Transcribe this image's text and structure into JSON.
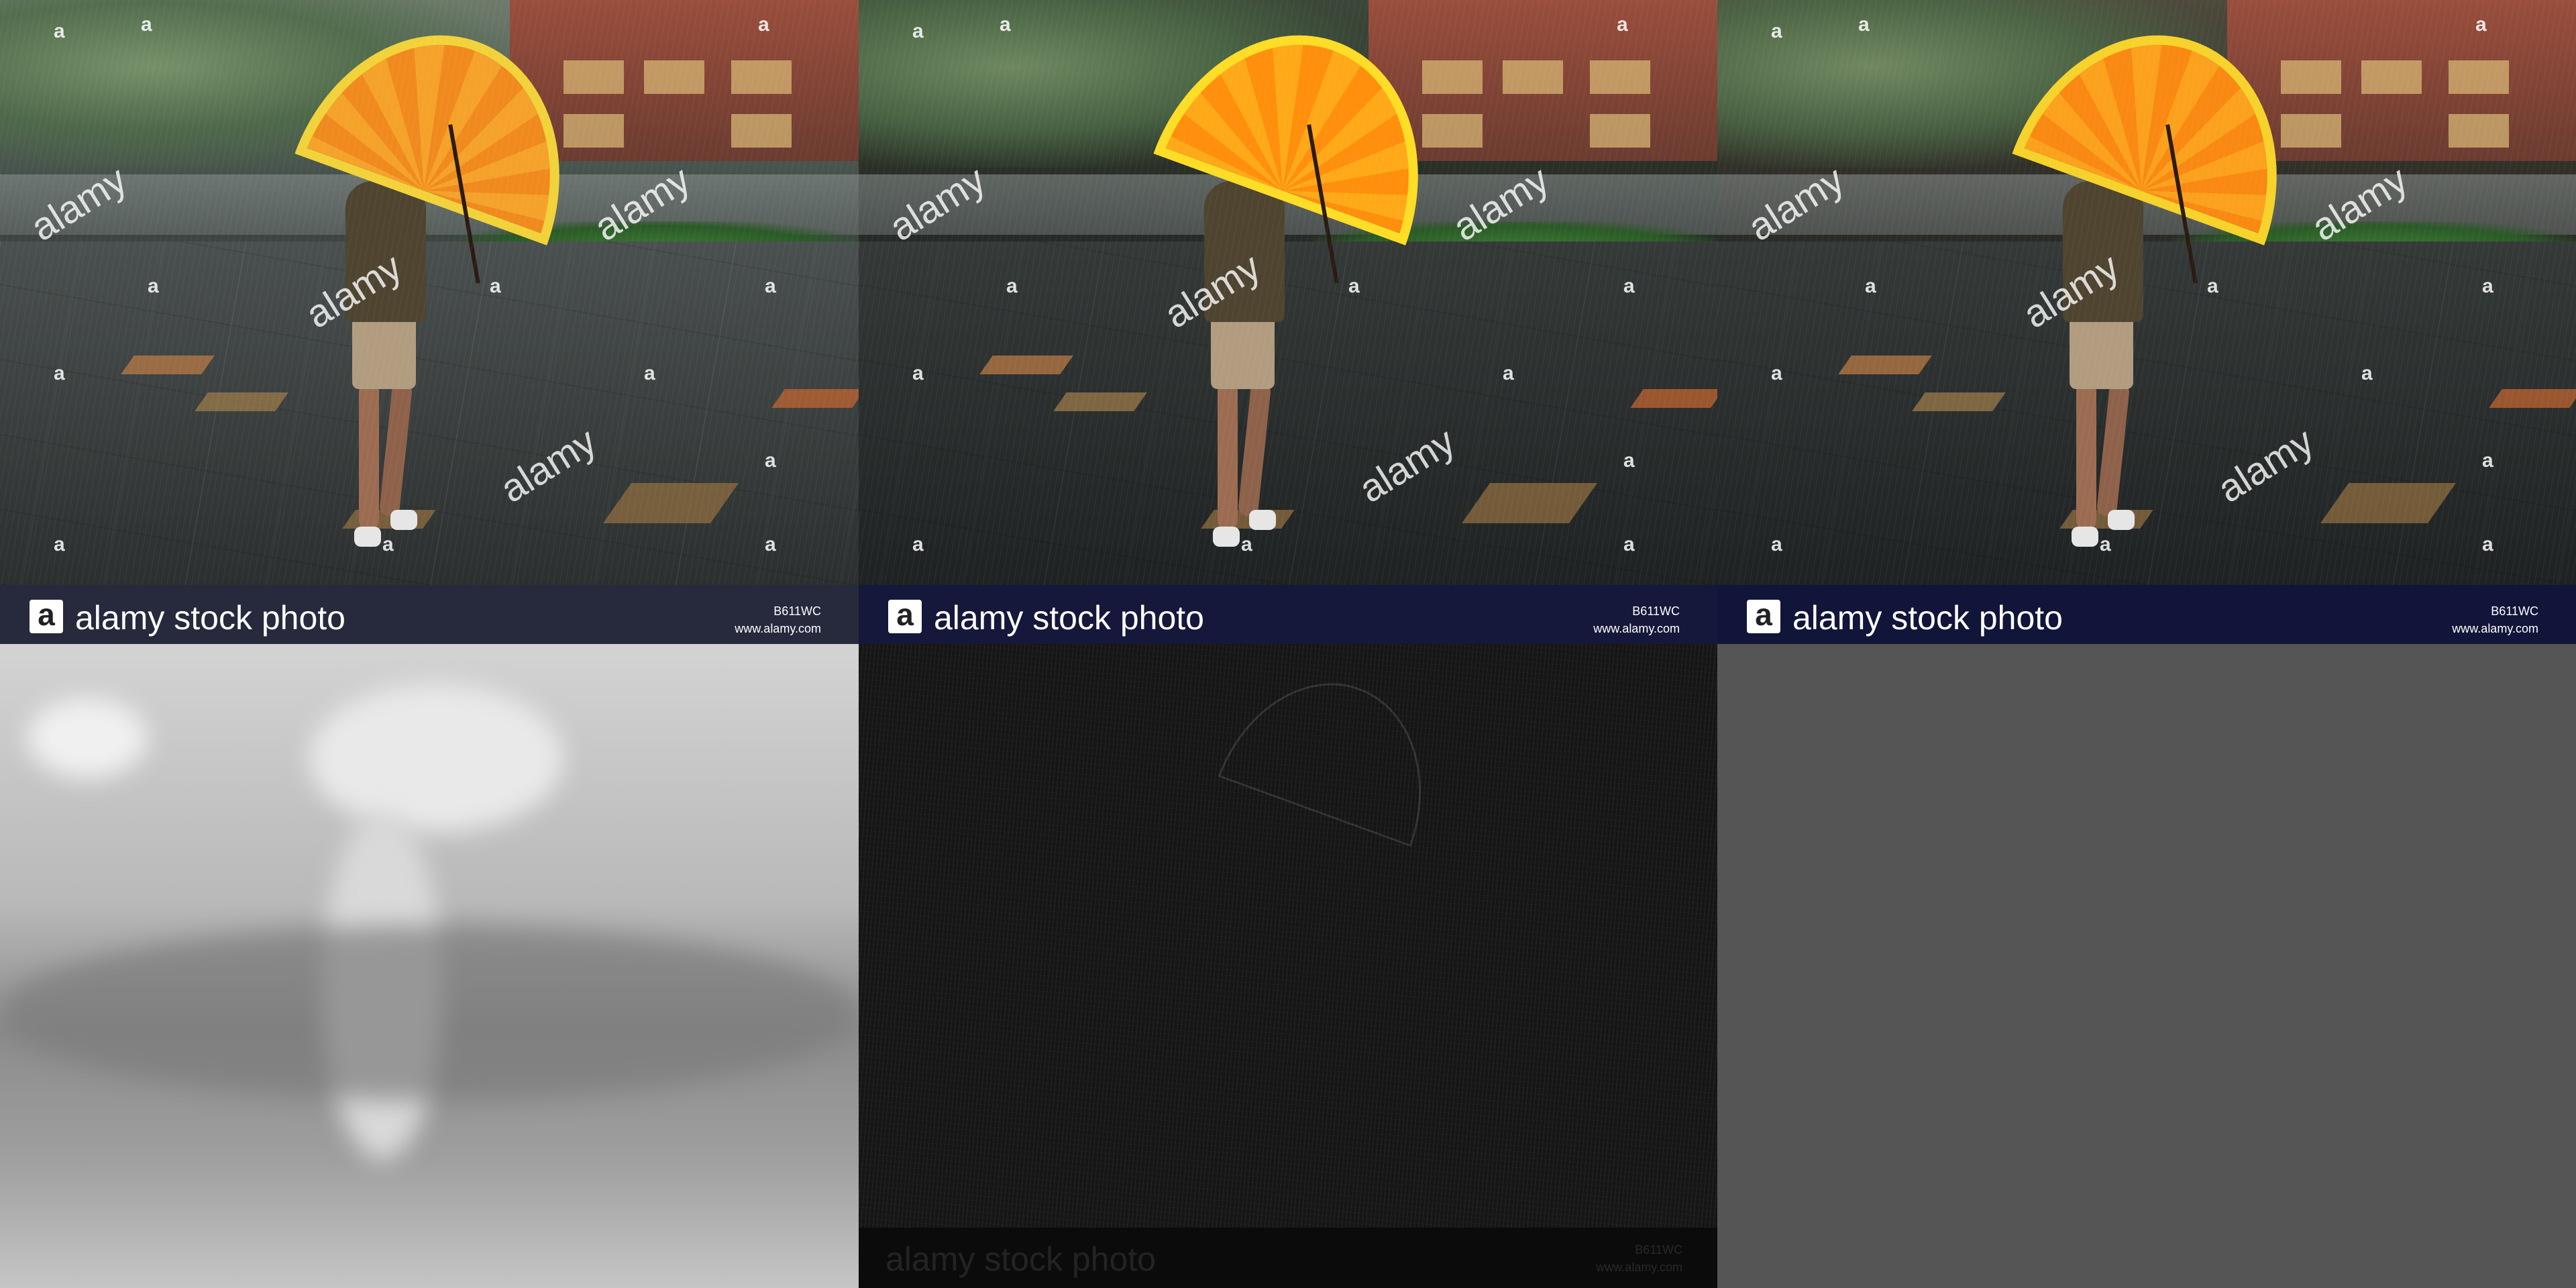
{
  "watermark": {
    "word": "alamy",
    "glyph": "a"
  },
  "banner": {
    "logo_glyph": "a",
    "brand_text": "alamy stock photo",
    "image_code": "B611WC",
    "site": "www.alamy.com"
  },
  "panels": [
    {
      "id": "original",
      "tone": "natural"
    },
    {
      "id": "enhanced",
      "tone": "darker"
    },
    {
      "id": "warm",
      "tone": "warmer"
    },
    {
      "id": "depth",
      "tone": "grayscale-depth"
    },
    {
      "id": "edges",
      "tone": "dark-edges"
    },
    {
      "id": "blank",
      "tone": "gray"
    }
  ],
  "colors": {
    "umbrella": "#f08a1e",
    "umbrella_trim": "#f2d23a",
    "banner": "#1b1f3a",
    "blank_panel": "#555555"
  }
}
